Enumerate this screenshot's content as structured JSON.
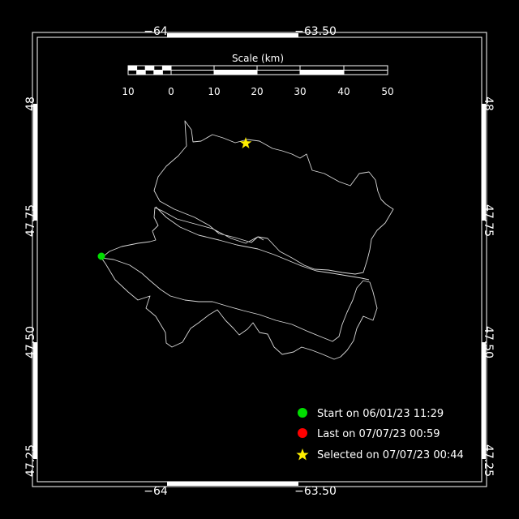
{
  "map": {
    "background": "#000000",
    "frame_color": "#ffffff",
    "track_color": "#d8d8d8",
    "axes": {
      "top_ticks": [
        "−64",
        "−63.50"
      ],
      "bottom_ticks": [
        "−64",
        "−63.50"
      ],
      "left_ticks": [
        "48",
        "47.75",
        "47.50",
        "47.25"
      ],
      "right_ticks": [
        "48",
        "47.75",
        "47.50",
        "47.25"
      ]
    },
    "scale_bar": {
      "title": "Scale (km)",
      "labels": [
        "10",
        "0",
        "10",
        "20",
        "30",
        "40",
        "50"
      ]
    },
    "legend": [
      {
        "label": "Start on 06/01/23 11:29",
        "color": "#00dd00",
        "marker": "circle"
      },
      {
        "label": "Last on 07/07/23 00:59",
        "color": "#ff0000",
        "marker": "circle"
      },
      {
        "label": "Selected on 07/07/23 00:44",
        "color": "#ffee00",
        "marker": "star-icon"
      }
    ],
    "markers": {
      "start": {
        "lon": -64.16,
        "lat": 47.69,
        "color": "#00dd00"
      },
      "selected": {
        "lon": -63.75,
        "lat": 47.92,
        "color": "#ffee00"
      }
    }
  }
}
